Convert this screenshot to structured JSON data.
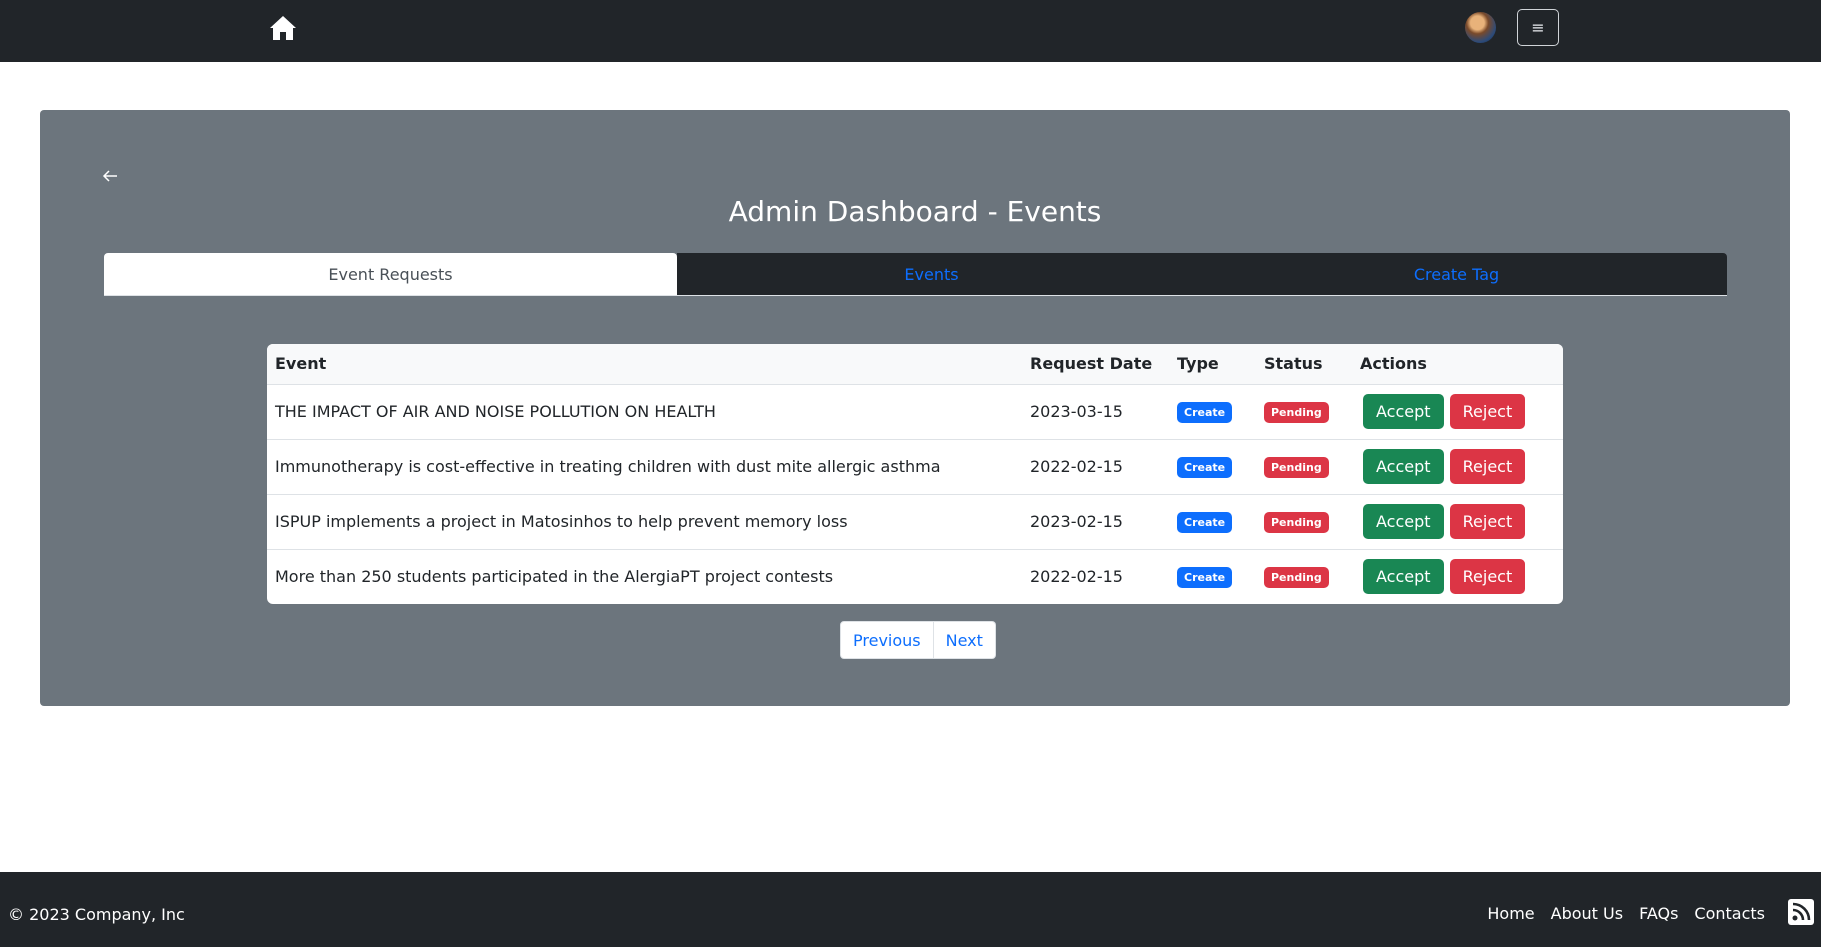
{
  "header": {
    "home_icon": "home-icon",
    "avatar_icon": "avatar",
    "menu_label": "≡"
  },
  "panel": {
    "back_icon": "arrow-left-icon",
    "title": "Admin Dashboard - Events",
    "tabs": [
      {
        "label": "Event Requests",
        "active": true
      },
      {
        "label": "Events",
        "active": false
      },
      {
        "label": "Create Tag",
        "active": false
      }
    ],
    "table": {
      "headers": [
        "Event",
        "Request Date",
        "Type",
        "Status",
        "Actions"
      ],
      "rows": [
        {
          "event": "THE IMPACT OF AIR AND NOISE POLLUTION ON HEALTH",
          "date": "2023-03-15",
          "type": "Create",
          "status": "Pending",
          "accept": "Accept",
          "reject": "Reject"
        },
        {
          "event": "Immunotherapy is cost-effective in treating children with dust mite allergic asthma",
          "date": "2022-02-15",
          "type": "Create",
          "status": "Pending",
          "accept": "Accept",
          "reject": "Reject"
        },
        {
          "event": "ISPUP implements a project in Matosinhos to help prevent memory loss",
          "date": "2023-02-15",
          "type": "Create",
          "status": "Pending",
          "accept": "Accept",
          "reject": "Reject"
        },
        {
          "event": "More than 250 students participated in the AlergiaPT project contests",
          "date": "2022-02-15",
          "type": "Create",
          "status": "Pending",
          "accept": "Accept",
          "reject": "Reject"
        }
      ]
    },
    "pagination": {
      "previous": "Previous",
      "next": "Next"
    }
  },
  "footer": {
    "copyright": "© 2023 Company, Inc",
    "links": [
      "Home",
      "About Us",
      "FAQs",
      "Contacts"
    ],
    "rss_icon": "rss-icon"
  },
  "colors": {
    "navbar": "#212529",
    "panel": "#6c757d",
    "primary": "#0d6efd",
    "success": "#198754",
    "danger": "#dc3545"
  }
}
